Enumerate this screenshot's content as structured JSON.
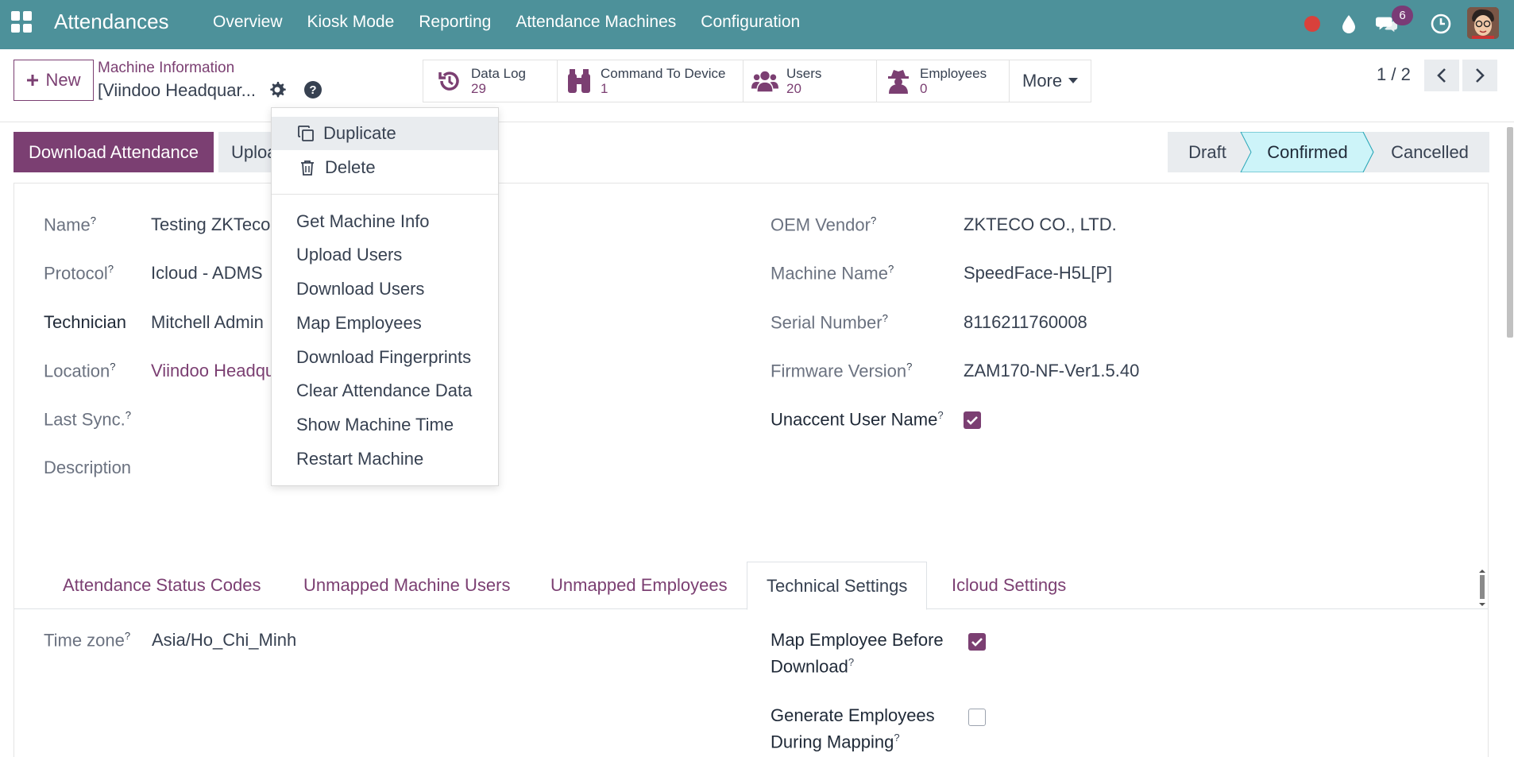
{
  "navbar": {
    "brand": "Attendances",
    "menu": [
      "Overview",
      "Kiosk Mode",
      "Reporting",
      "Attendance Machines",
      "Configuration"
    ],
    "chat_badge": "6"
  },
  "control_panel": {
    "new_label": "New",
    "breadcrumb": "Machine Information",
    "record_title": "[Viindoo Headquar...",
    "smart_buttons": [
      {
        "label": "Data Log",
        "value": "29",
        "icon": "history-icon"
      },
      {
        "label": "Command To Device",
        "value": "1",
        "icon": "binoculars-icon"
      },
      {
        "label": "Users",
        "value": "20",
        "icon": "users-icon"
      },
      {
        "label": "Employees",
        "value": "0",
        "icon": "user-secret-icon"
      }
    ],
    "more_label": "More",
    "pager": "1 / 2"
  },
  "status_bar": {
    "download_label": "Download Attendance",
    "upload_label": "Uploa",
    "stages": [
      "Draft",
      "Confirmed",
      "Cancelled"
    ],
    "active_stage": "Confirmed"
  },
  "form": {
    "left": [
      {
        "label": "Name",
        "help": "?",
        "value": "Testing ZKTeco"
      },
      {
        "label": "Protocol",
        "help": "?",
        "value": "Icloud - ADMS"
      },
      {
        "label": "Technician",
        "help": "",
        "value": "Mitchell Admin"
      },
      {
        "label": "Location",
        "help": "?",
        "value": "Viindoo Headqu"
      },
      {
        "label": "Last Sync.",
        "help": "?",
        "value": ""
      },
      {
        "label": "Description",
        "help": "",
        "value": ""
      }
    ],
    "right": [
      {
        "label": "OEM Vendor",
        "help": "?",
        "value": "ZKTECO CO., LTD."
      },
      {
        "label": "Machine Name",
        "help": "?",
        "value": "SpeedFace-H5L[P]"
      },
      {
        "label": "Serial Number",
        "help": "?",
        "value": "8116211760008"
      },
      {
        "label": "Firmware Version",
        "help": "?",
        "value": "ZAM170-NF-Ver1.5.40"
      },
      {
        "label": "Unaccent User Name",
        "help": "?",
        "checked": true
      }
    ],
    "tabs": [
      "Attendance Status Codes",
      "Unmapped Machine Users",
      "Unmapped Employees",
      "Technical Settings",
      "Icloud Settings"
    ],
    "active_tab": "Technical Settings",
    "technical": {
      "timezone_label": "Time zone",
      "timezone_help": "?",
      "timezone_value": "Asia/Ho_Chi_Minh",
      "map_employee_label_1": "Map Employee Before",
      "map_employee_label_2": "Download",
      "map_employee_help": "?",
      "map_employee_checked": true,
      "generate_label_1": "Generate Employees",
      "generate_label_2": "During Mapping",
      "generate_help": "?",
      "generate_checked": false
    }
  },
  "action_menu": {
    "items_top": [
      {
        "label": "Duplicate",
        "icon": "copy-icon"
      },
      {
        "label": "Delete",
        "icon": "trash-icon"
      }
    ],
    "items": [
      "Get Machine Info",
      "Upload Users",
      "Download Users",
      "Map Employees",
      "Download Fingerprints",
      "Clear Attendance Data",
      "Show Machine Time",
      "Restart Machine"
    ]
  },
  "colors": {
    "navbar": "#4d919a",
    "primary": "#7b3f72",
    "active_stage": "#cdf4f9"
  }
}
